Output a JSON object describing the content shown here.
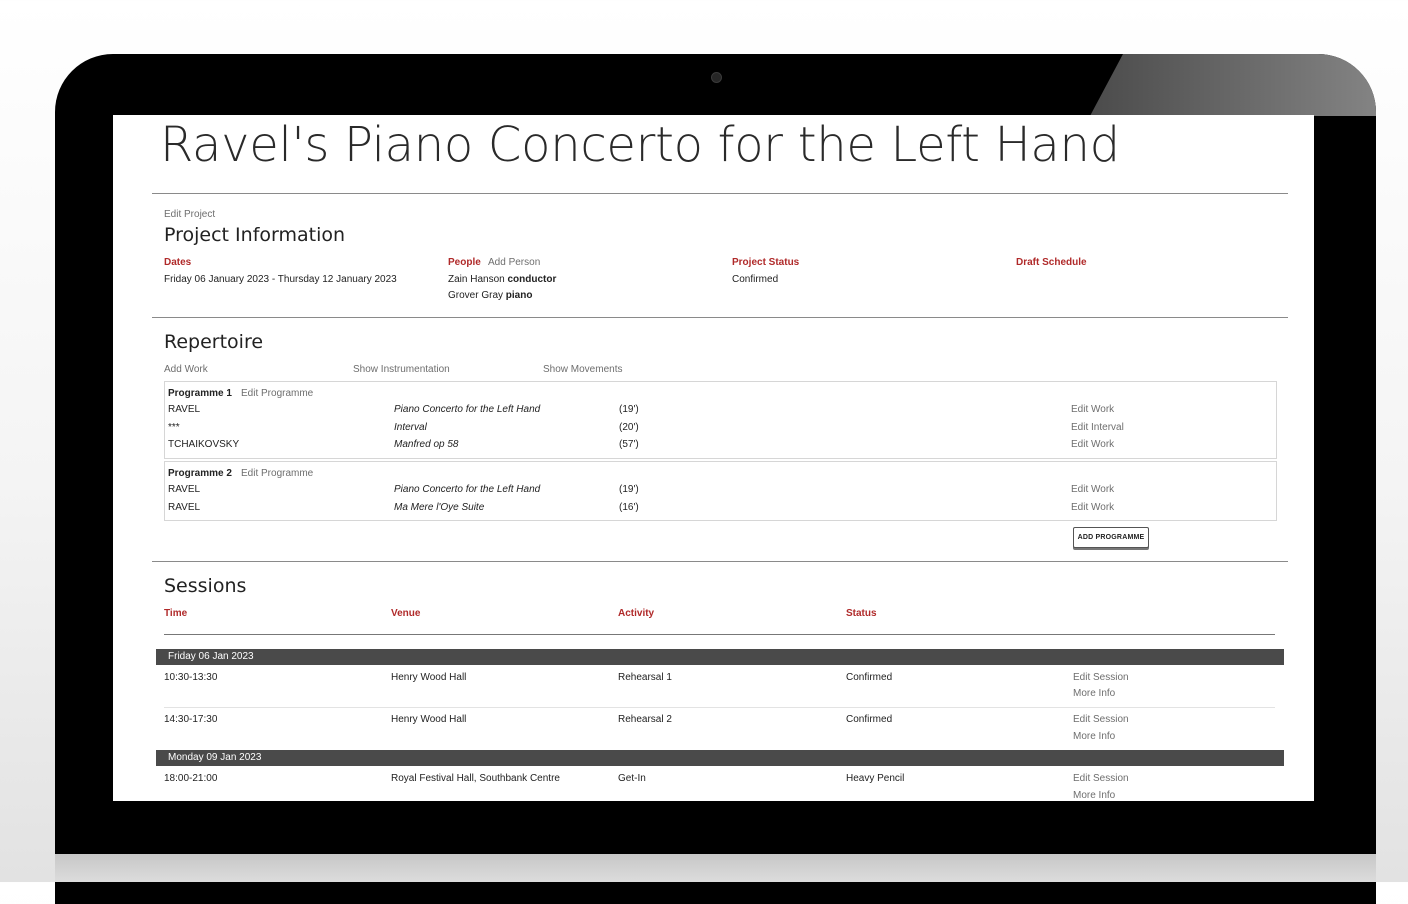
{
  "page": {
    "title": "Ravel's Piano Concerto for the Left Hand"
  },
  "project": {
    "edit_label": "Edit Project",
    "heading": "Project Information",
    "dates_label": "Dates",
    "dates_value": "Friday 06 January 2023 - Thursday 12 January 2023",
    "people_label": "People",
    "add_person_label": "Add Person",
    "people": [
      {
        "name": "Zain Hanson",
        "role": "conductor"
      },
      {
        "name": "Grover Gray",
        "role": "piano"
      }
    ],
    "status_label": "Project Status",
    "status_value": "Confirmed",
    "draft_schedule_label": "Draft Schedule"
  },
  "repertoire": {
    "heading": "Repertoire",
    "add_work": "Add Work",
    "show_instrumentation": "Show Instrumentation",
    "show_movements": "Show Movements",
    "programmes": [
      {
        "label": "Programme 1",
        "edit_label": "Edit Programme",
        "works": [
          {
            "composer": "RAVEL",
            "work": "Piano Concerto for the Left Hand",
            "duration": "(19')",
            "action": "Edit Work"
          },
          {
            "composer": "***",
            "work": "Interval",
            "duration": "(20')",
            "action": "Edit Interval"
          },
          {
            "composer": "TCHAIKOVSKY",
            "work": "Manfred op 58",
            "duration": "(57')",
            "action": "Edit Work"
          }
        ]
      },
      {
        "label": "Programme 2",
        "edit_label": "Edit Programme",
        "works": [
          {
            "composer": "RAVEL",
            "work": "Piano Concerto for the Left Hand",
            "duration": "(19')",
            "action": "Edit Work"
          },
          {
            "composer": "RAVEL",
            "work": "Ma Mere l'Oye Suite",
            "duration": "(16')",
            "action": "Edit Work"
          }
        ]
      }
    ],
    "add_programme": "ADD PROGRAMME"
  },
  "sessions": {
    "heading": "Sessions",
    "columns": {
      "time": "Time",
      "venue": "Venue",
      "activity": "Activity",
      "status": "Status"
    },
    "days": [
      {
        "label": "Friday 06 Jan 2023",
        "rows": [
          {
            "time": "10:30-13:30",
            "venue": "Henry Wood Hall",
            "activity": "Rehearsal 1",
            "status": "Confirmed",
            "edit": "Edit Session",
            "more": "More Info"
          },
          {
            "time": "14:30-17:30",
            "venue": "Henry Wood Hall",
            "activity": "Rehearsal 2",
            "status": "Confirmed",
            "edit": "Edit Session",
            "more": "More Info"
          }
        ]
      },
      {
        "label": "Monday 09 Jan 2023",
        "rows": [
          {
            "time": "18:00-21:00",
            "venue": "Royal Festival Hall, Southbank Centre",
            "activity": "Get-In",
            "status": "Heavy Pencil",
            "edit": "Edit Session",
            "more": "More Info"
          }
        ]
      }
    ]
  },
  "colors": {
    "accent": "#b02a2a",
    "day_bar": "#4a4a4a",
    "frame": "#000000"
  }
}
